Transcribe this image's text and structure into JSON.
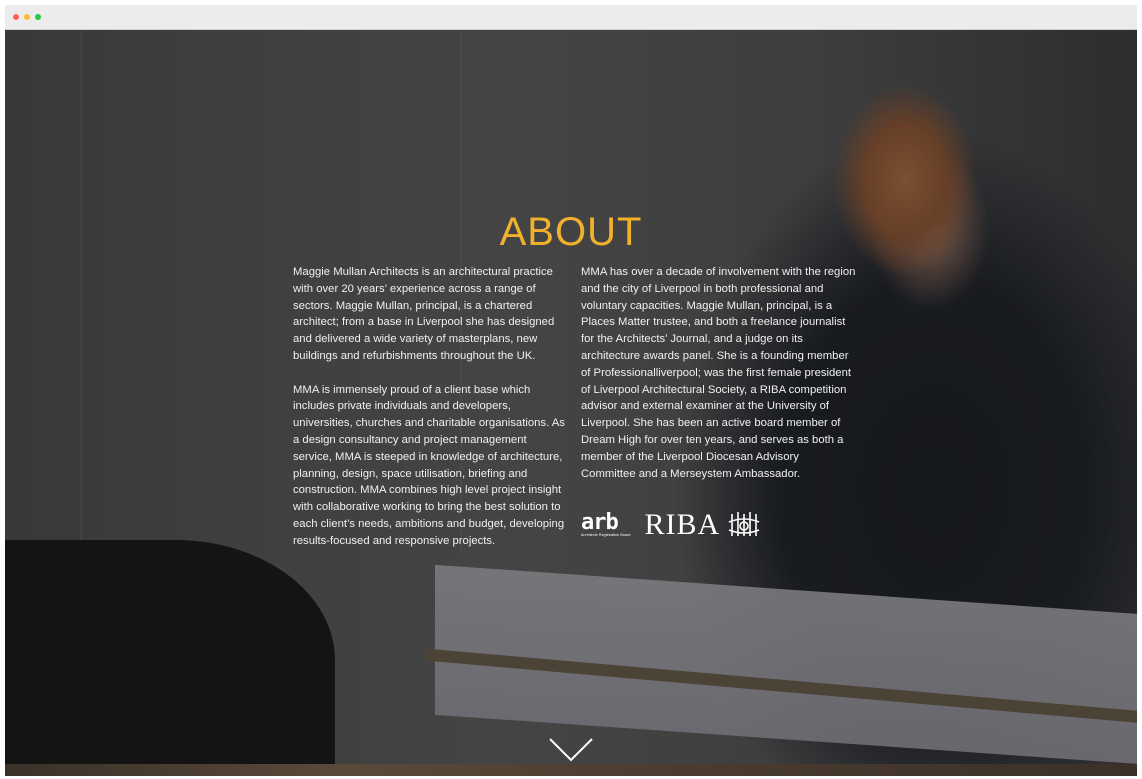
{
  "section": {
    "title": "ABOUT",
    "title_color": "#f1b12c"
  },
  "left_column": {
    "paragraphs": [
      "Maggie Mullan Architects is an architectural practice with over 20 years’ experience across a range of sectors. Maggie Mullan, principal, is a chartered architect; from a base in Liverpool she has designed and delivered a wide variety of masterplans, new buildings and refurbishments throughout the UK.",
      "MMA is immensely proud of a client base which includes private individuals and developers, universities, churches and charitable organisations. As a design consultancy and project management service, MMA is steeped in knowledge of architecture, planning, design, space utilisation, briefing and construction. MMA combines high level project insight with collaborative working to bring the best solution to each client’s needs, ambitions and budget, developing results-focused and responsive projects."
    ]
  },
  "right_column": {
    "paragraphs": [
      "MMA has over a decade of involvement with the region and the city of Liverpool in both professional and voluntary capacities. Maggie Mullan, principal, is a Places Matter trustee, and both a freelance journalist for the Architects’ Journal, and a judge on its architecture awards panel. She is a founding member of Professionalliverpool; was the first female president of Liverpool Architectural Society, a RIBA competition advisor and external examiner at the University of Liverpool. She has been an active board member of Dream High for over ten years, and serves as both a member of the Liverpool Diocesan Advisory Committee and a Merseystem Ambassador."
    ]
  },
  "logos": {
    "arb_word": "arb",
    "arb_sub": "Architects Registration Board",
    "riba_word": "RIBA"
  },
  "icons": {
    "scroll_down": "chevron-down-icon",
    "riba_crest": "riba-crest-icon"
  }
}
